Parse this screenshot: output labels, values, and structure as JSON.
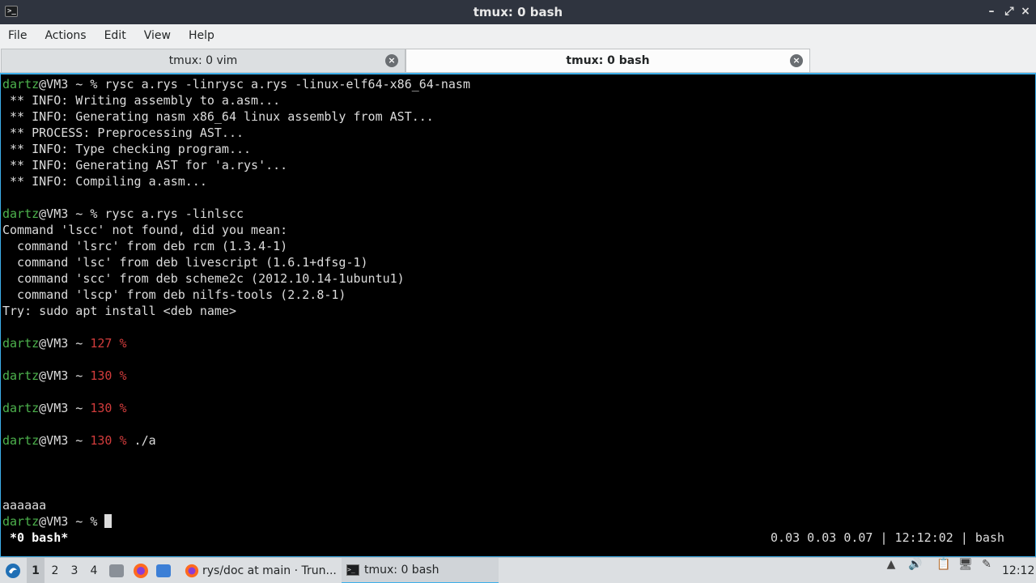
{
  "window": {
    "title": "tmux: 0 bash",
    "app_icon_glyph": ">_",
    "minimize_glyph": "–",
    "maximize_glyph": "⤢",
    "close_glyph": "×"
  },
  "menu": [
    "File",
    "Actions",
    "Edit",
    "View",
    "Help"
  ],
  "tabs": [
    {
      "label": "tmux: 0 vim",
      "active": false
    },
    {
      "label": "tmux: 0 bash",
      "active": true
    }
  ],
  "tab_close_glyph": "×",
  "terminal": {
    "prompt_user": "dartz",
    "prompt_host": "@VM3 ~ ",
    "lines": [
      {
        "kind": "prompt",
        "code": "",
        "cmd": "% rysc a.rys -linrysc a.rys -linux-elf64-x86_64-nasm"
      },
      {
        "kind": "out",
        "text": " ** INFO: Writing assembly to a.asm..."
      },
      {
        "kind": "out",
        "text": " ** INFO: Generating nasm x86_64 linux assembly from AST..."
      },
      {
        "kind": "out",
        "text": " ** PROCESS: Preprocessing AST..."
      },
      {
        "kind": "out",
        "text": " ** INFO: Type checking program..."
      },
      {
        "kind": "out",
        "text": " ** INFO: Generating AST for 'a.rys'..."
      },
      {
        "kind": "out",
        "text": " ** INFO: Compiling a.asm..."
      },
      {
        "kind": "out",
        "text": ""
      },
      {
        "kind": "prompt",
        "code": "",
        "cmd": "% rysc a.rys -linlscc"
      },
      {
        "kind": "out",
        "text": "Command 'lscc' not found, did you mean:"
      },
      {
        "kind": "out",
        "text": "  command 'lsrc' from deb rcm (1.3.4-1)"
      },
      {
        "kind": "out",
        "text": "  command 'lsc' from deb livescript (1.6.1+dfsg-1)"
      },
      {
        "kind": "out",
        "text": "  command 'scc' from deb scheme2c (2012.10.14-1ubuntu1)"
      },
      {
        "kind": "out",
        "text": "  command 'lscp' from deb nilfs-tools (2.2.8-1)"
      },
      {
        "kind": "out",
        "text": "Try: sudo apt install <deb name>"
      },
      {
        "kind": "out",
        "text": ""
      },
      {
        "kind": "prompt",
        "code": "127 %",
        "cmd": ""
      },
      {
        "kind": "out",
        "text": ""
      },
      {
        "kind": "prompt",
        "code": "130 %",
        "cmd": ""
      },
      {
        "kind": "out",
        "text": ""
      },
      {
        "kind": "prompt",
        "code": "130 %",
        "cmd": ""
      },
      {
        "kind": "out",
        "text": ""
      },
      {
        "kind": "prompt",
        "code": "130 %",
        "cmd": " ./a"
      },
      {
        "kind": "out",
        "text": ""
      },
      {
        "kind": "out",
        "text": ""
      },
      {
        "kind": "out",
        "text": ""
      },
      {
        "kind": "out",
        "text": "aaaaaa"
      },
      {
        "kind": "cursor",
        "code": "",
        "cmd": "% "
      }
    ],
    "status_left": " *0 bash*",
    "status_right": "0.03 0.03 0.07 | 12:12:02 | bash"
  },
  "taskbar": {
    "workspaces": [
      "1",
      "2",
      "3",
      "4"
    ],
    "active_workspace": "1",
    "launchers": [
      "file-manager-icon",
      "firefox-icon",
      "folder-icon"
    ],
    "tasks": [
      {
        "label": "rys/doc at main · Trun...",
        "icon": "firefox-icon",
        "active": false
      },
      {
        "label": "tmux: 0 bash",
        "icon": "terminal-icon",
        "active": true
      }
    ],
    "clock": "12:12",
    "colors": {
      "accent": "#3daee9",
      "firefox": "#ff6a1f",
      "folder": "#3c7fd6"
    }
  }
}
